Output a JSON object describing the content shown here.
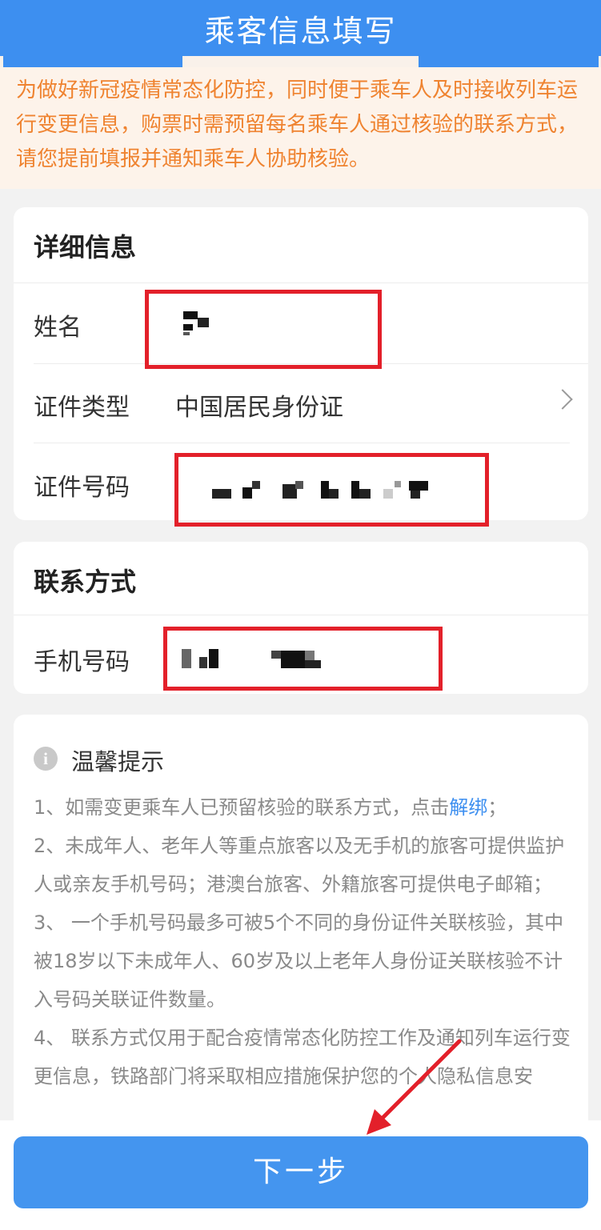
{
  "header": {
    "title": "乘客信息填写"
  },
  "notice": {
    "text": "为做好新冠疫情常态化防控，同时便于乘车人及时接收列车运行变更信息，购票时需预留每名乘车人通过核验的联系方式，请您提前填报并通知乘车人协助核验。"
  },
  "details": {
    "title": "详细信息",
    "name_label": "姓名",
    "id_type_label": "证件类型",
    "id_type_value": "中国居民身份证",
    "id_number_label": "证件号码"
  },
  "contact": {
    "title": "联系方式",
    "phone_label": "手机号码"
  },
  "tips": {
    "title": "温馨提示",
    "icon": "info-icon",
    "item1_text": "1、如需变更乘车人已预留核验的联系方式，点击",
    "item1_link": "解绑",
    "item1_end": "；",
    "item2": "2、未成年人、老年人等重点旅客以及无手机的旅客可提供监护人或亲友手机号码；港澳台旅客、外籍旅客可提供电子邮箱；",
    "item3": "3、 一个手机号码最多可被5个不同的身份证件关联核验，其中被18岁以下未成年人、60岁及以上老年人身份证关联核验不计入号码关联证件数量。",
    "item4": "4、 联系方式仅用于配合疫情常态化防控工作及通知列车运行变更信息，铁路部门将采取相应措施保护您的个人隐私信息安"
  },
  "footer": {
    "next_label": "下一步"
  },
  "colors": {
    "primary": "#3d8ff0",
    "highlight": "#e3202a",
    "notice_text": "#ef8330"
  }
}
